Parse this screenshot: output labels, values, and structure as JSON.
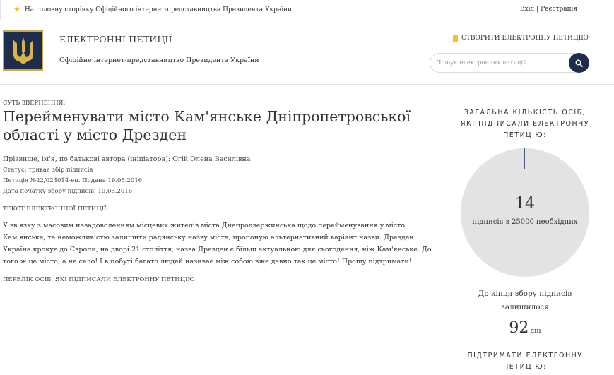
{
  "topbar": {
    "home_link": "На головну сторінку Офіційного інтернет-представництва Президента України",
    "login": "Вхід",
    "separator": "|",
    "register": "Реєстрація"
  },
  "header": {
    "title": "ЕЛЕКТРОННІ ПЕТИЦІЇ",
    "subtitle": "Офіційне інтернет-представництво Президента України",
    "create_button": "СТВОРИТИ ЕЛЕКТРОННУ ПЕТИЦІЮ",
    "search_placeholder": "Пошук електронних петицій"
  },
  "petition": {
    "essence_label": "СУТЬ ЗВЕРНЕННЯ:",
    "title": "Перейменувати місто Кам'янське Дніпропетровської області у місто Дрезден",
    "author": "Прізвище, ім'я, по батькові автора (ініціатора): Огій Олена Василівна",
    "status": "Статус: триває збір підписів",
    "number": "Петиція №22/024014-еп. Подана 19.05.2016",
    "start_date": "Дата початку збору підписів: 19.05.2016",
    "text_label": "ТЕКСТ ЕЛЕКТРОННОЇ ПЕТИЦІЇ:",
    "text": "У зв'язку з масовим незадоволенням місцевих жителів міста Днепродзержинська щодо перейменування у місто Кам'янське, та неможливістю залишити радянську назву міста, пропоную альтернативний варіант назви: Дрезден. Україна крокує до Європи, на дворі 21 століття, назва Дрезден є більш актуальною для сьогодення, ніж Кам'янське. До того ж це місто, а не село! І в побуті багато людей називає між собою вже давно так це місто! Прошу підтримати!",
    "signers_link": "ПЕРЕЛІК ОСІБ, ЯКІ ПІДПИСАЛИ ЕЛЕКТРОННУ ПЕТИЦІЮ"
  },
  "sidebar": {
    "total_heading": "ЗАГАЛЬНА КІЛЬКІСТЬ ОСІБ, ЯКІ ПІДПИСАЛИ ЕЛЕКТРОННУ ПЕТИЦІЮ:",
    "signature_count": "14",
    "required_text": "підписів з 25000 необхідних",
    "signatures_collected": 14,
    "signatures_required": 25000,
    "remaining_label": "До кінця збору підписів залишилося",
    "days_left": "92",
    "days_unit": "дні",
    "support_heading": "ПІДТРИМАТИ ЕЛЕКТРОННУ ПЕТИЦІЮ:"
  },
  "colors": {
    "navy": "#1f2d4d",
    "gold": "#f2c02f",
    "pie_bg": "#e3e3e3"
  }
}
